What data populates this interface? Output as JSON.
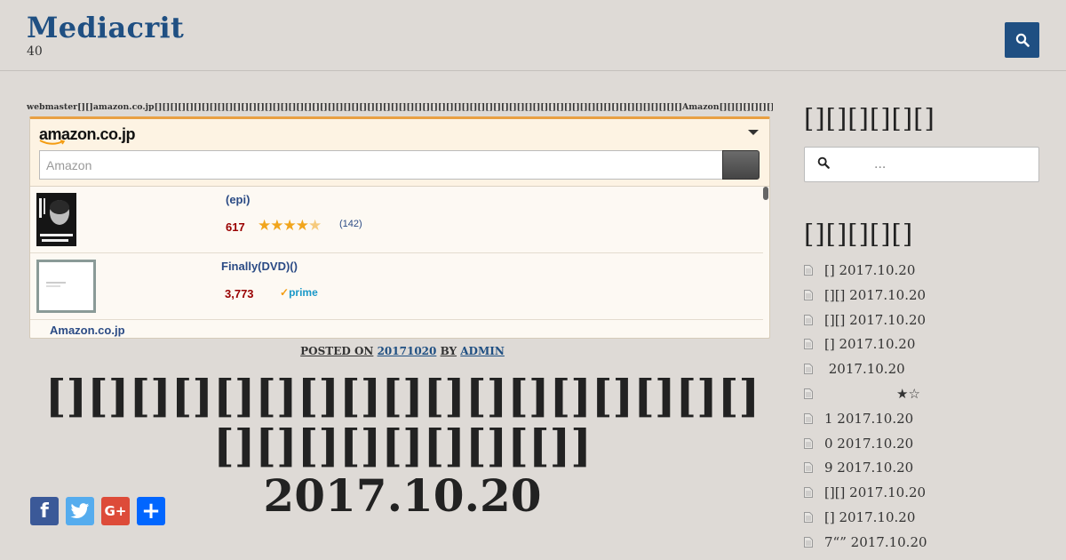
{
  "header": {
    "site_title": "Mediacrit",
    "site_description": "40",
    "search_button_icon": "search-icon"
  },
  "disclaimer": "webmaster[][]amazon.co.jp[][][][][][][][][][][][][][][][][][][][][][][][][][][][][][][][][][][][][][][][][][][][][][][][][][][][][][][][][][][][][][][][][][][]Amazon[][][][][][][][][][][][][][][][][][][][]",
  "amazon_widget": {
    "logo": "amazon.co.jp",
    "search_placeholder": "Amazon",
    "items": [
      {
        "title": "(epi)",
        "price": "617",
        "rating": 4.5,
        "reviews": "(142)",
        "thumb_text": "KAZUO ISHIGURO"
      },
      {
        "title": "Finally(DVD)()",
        "price": "3,773",
        "prime_label": "prime"
      }
    ],
    "footer_link": "Amazon.co.jp"
  },
  "post": {
    "meta_posted_on": "POSTED ON",
    "meta_date": "20171020",
    "meta_by": "BY",
    "meta_author": "ADMIN",
    "title_line1": "[][][][][][][][][][][][][][][][][][][][][][][][]",
    "title_line1_bracket": "[[]]",
    "title_line2": "2017.10.20"
  },
  "share": {
    "facebook": "f",
    "twitter": "twitter-bird-icon",
    "googleplus": "G+",
    "share_more": "+"
  },
  "sidebar": {
    "search_heading": "[][][][][][]",
    "search_placeholder": "...",
    "recent_heading": "[][][][][]",
    "recent_posts": [
      "[] 2017.10.20",
      "[][] 2017.10.20",
      "[][] 2017.10.20",
      "[] 2017.10.20",
      " 2017.10.20",
      "                 ★☆",
      "1 2017.10.20",
      "0 2017.10.20",
      "9 2017.10.20",
      "[][] 2017.10.20",
      "[] 2017.10.20",
      "7“” 2017.10.20"
    ]
  },
  "colors": {
    "background": "#dedad6",
    "brand_blue": "#1f4f82",
    "amazon_orange": "#e8a043",
    "price_red": "#990000",
    "link_blue": "#2b4b85",
    "star_gold": "#f1a51c"
  }
}
